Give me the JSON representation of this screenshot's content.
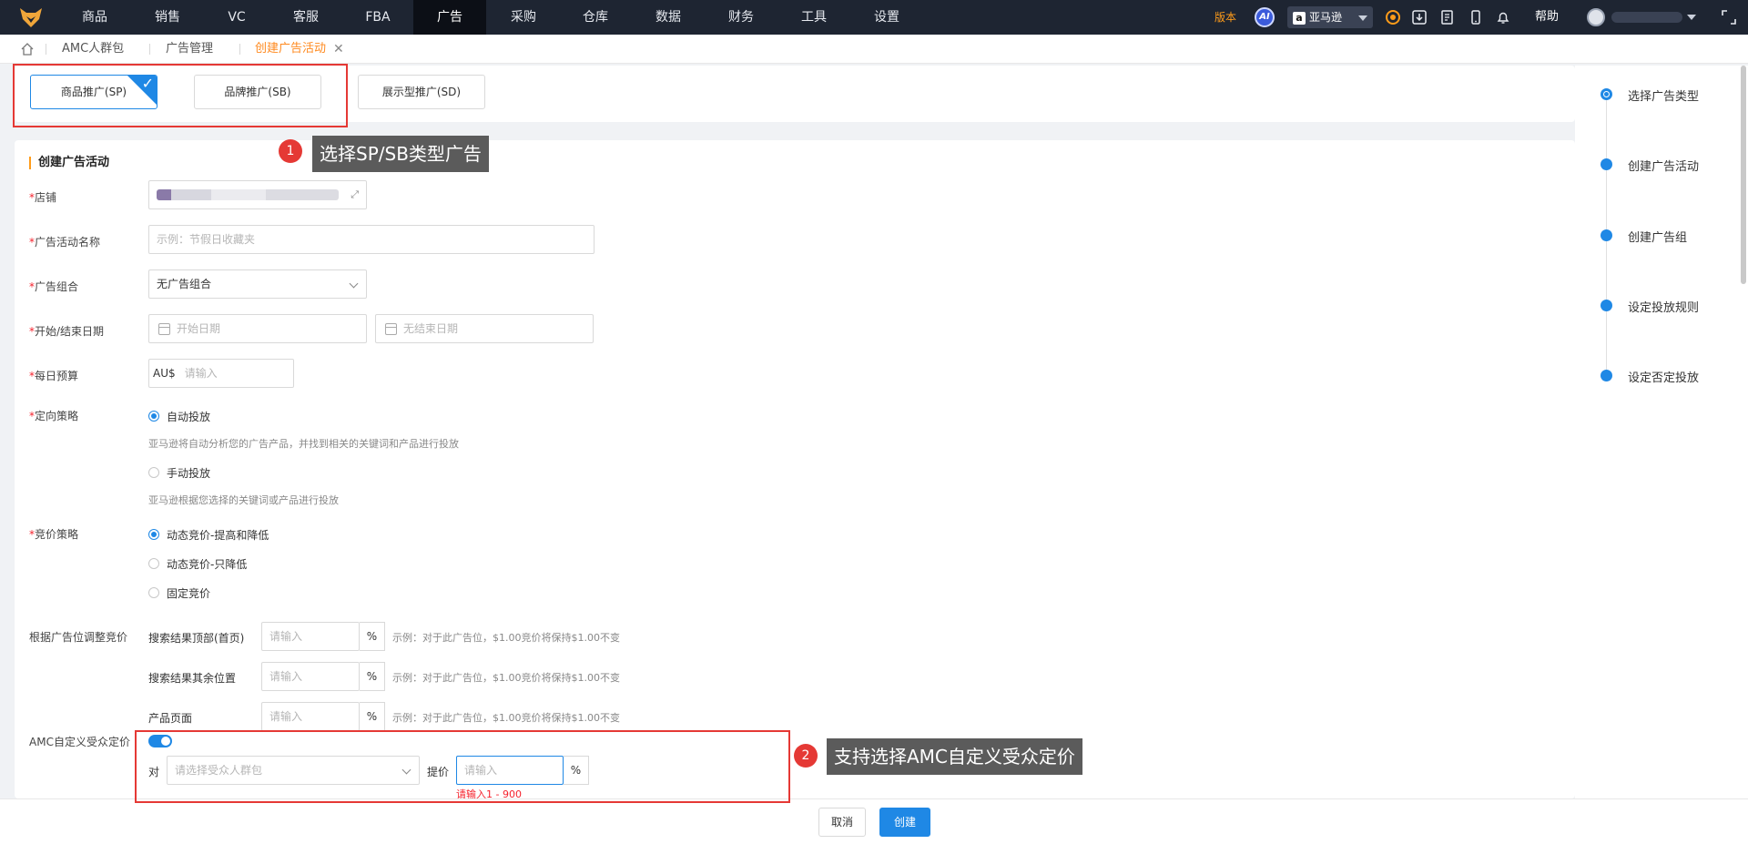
{
  "nav": {
    "items": [
      "商品",
      "销售",
      "VC",
      "客服",
      "FBA",
      "广告",
      "采购",
      "仓库",
      "数据",
      "财务",
      "工具",
      "设置"
    ],
    "active": "广告",
    "version": "版本",
    "ai": "AI",
    "store": "亚马逊",
    "help": "帮助"
  },
  "tabs": {
    "items": [
      "AMC人群包",
      "广告管理",
      "创建广告活动"
    ],
    "close": "✕"
  },
  "ad_types": {
    "sp": "商品推广(SP)",
    "sb": "品牌推广(SB)",
    "sd": "展示型推广(SD)",
    "selected": "sp"
  },
  "form": {
    "title": "创建广告活动",
    "store_label": "店铺",
    "name_label": "广告活动名称",
    "name_placeholder": "示例：节假日收藏夹",
    "portfolio_label": "广告组合",
    "portfolio_value": "无广告组合",
    "date_label": "开始/结束日期",
    "start_placeholder": "开始日期",
    "end_placeholder": "无结束日期",
    "budget_label": "每日预算",
    "currency": "AU$",
    "budget_placeholder": "请输入",
    "targeting_label": "定向策略",
    "auto_label": "自动投放",
    "auto_desc": "亚马逊将自动分析您的广告产品，并找到相关的关键词和产品进行投放",
    "manual_label": "手动投放",
    "manual_desc": "亚马逊根据您选择的关键词或产品进行投放",
    "bidding_label": "竞价策略",
    "bid_up_down": "动态竞价-提高和降低",
    "bid_down": "动态竞价-只降低",
    "bid_fixed": "固定竞价",
    "placement_label": "根据广告位调整竞价",
    "placement_top": "搜索结果顶部(首页)",
    "placement_rest": "搜索结果其余位置",
    "placement_product": "产品页面",
    "pct_placeholder": "请输入",
    "pct": "%",
    "placement_hint": "示例：对于此广告位，$1.00竞价将保持$1.00不变",
    "amc_label": "AMC自定义受众定价",
    "amc_for": "对",
    "amc_audience_placeholder": "请选择受众人群包",
    "amc_bid_label": "提价",
    "amc_bid_placeholder": "请输入",
    "amc_error": "请输入1 - 900"
  },
  "steps": [
    "选择广告类型",
    "创建广告活动",
    "创建广告组",
    "设定投放规则",
    "设定否定投放"
  ],
  "footer": {
    "cancel": "取消",
    "create": "创建"
  },
  "annotations": {
    "n1": "1",
    "c1": "选择SP/SB类型广告",
    "n2": "2",
    "c2": "支持选择AMC自定义受众定价"
  },
  "colors": {
    "nav_bg": "#1e2532",
    "accent": "#1f88e5",
    "brand_orange": "#ff9c1a",
    "required": "#f5222d",
    "annotation_red": "#e53935"
  }
}
